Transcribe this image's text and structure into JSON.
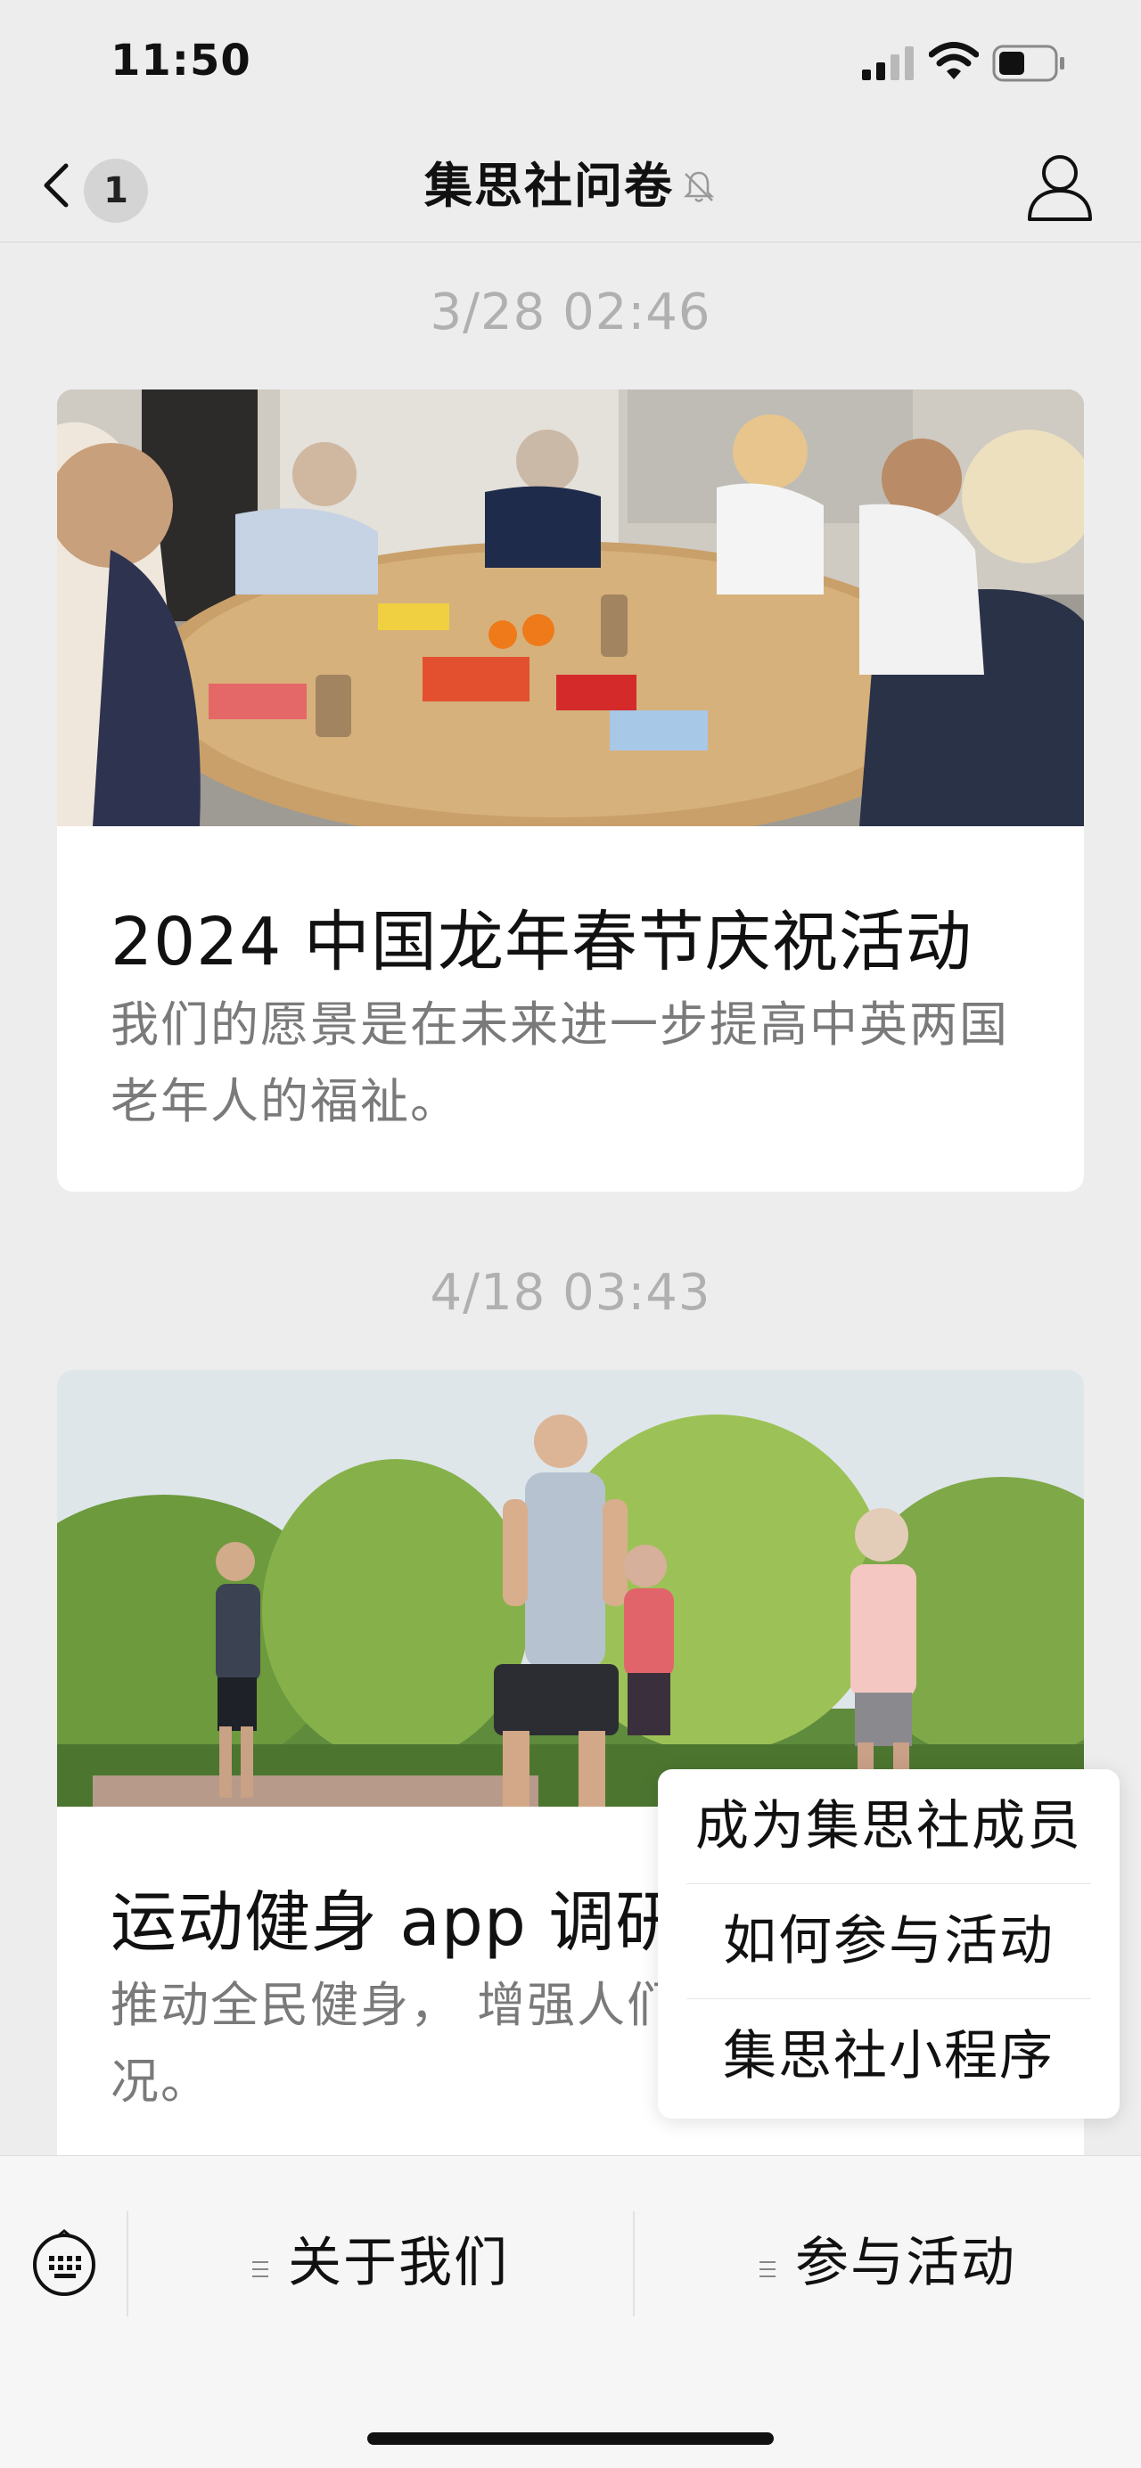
{
  "status_bar": {
    "time": "11:50",
    "signal_icon": "cellular-signal-icon",
    "wifi_icon": "wifi-icon",
    "battery_icon": "battery-icon"
  },
  "nav": {
    "back_icon": "chevron-left-icon",
    "unread_count": "1",
    "title": "集思社问卷",
    "mute_icon": "bell-muted-icon",
    "profile_icon": "person-icon"
  },
  "messages": [
    {
      "timestamp": "3/28 02:46",
      "image": "photo-seniors-crafting-at-table",
      "title": "2024 中国龙年春节庆祝活动",
      "description": "我们的愿景是在未来进一步提高中英两国老年人的福祉。"
    },
    {
      "timestamp": "4/18 03:43",
      "image": "photo-seniors-jogging-in-park",
      "title": "运动健身 app 调研",
      "description": "推动全民健身，增强人们的身体健康状况。",
      "visible_description": "推动全民健身， 增强人们的身体健康状况。"
    }
  ],
  "popup_menu": {
    "items": [
      {
        "label": "成为集思社成员"
      },
      {
        "label": "如何参与活动"
      },
      {
        "label": "集思社小程序"
      }
    ]
  },
  "bottom_menu": {
    "keyboard_icon": "keyboard-icon",
    "menu_icon": "menu-lines-icon",
    "items": [
      {
        "label": "关于我们"
      },
      {
        "label": "参与活动"
      }
    ]
  },
  "colors": {
    "background": "#ededed",
    "card": "#ffffff",
    "timestamp": "#b0b0b0",
    "description": "#7a7a7a",
    "text": "#111111"
  }
}
